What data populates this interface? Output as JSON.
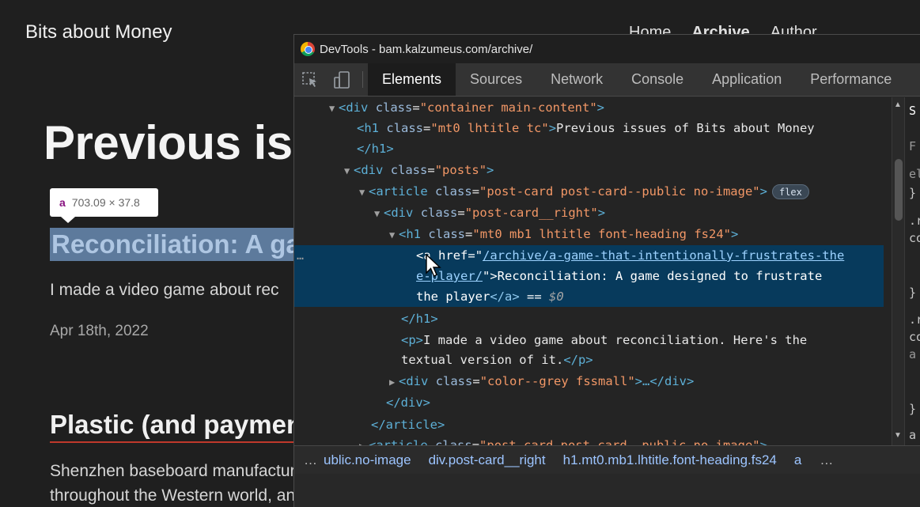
{
  "site": {
    "title": "Bits about Money",
    "nav": [
      "Home",
      "Archive",
      "Author"
    ],
    "heading": "Previous issu"
  },
  "inspect_tooltip": {
    "tag": "a",
    "size": "703.09 × 37.8"
  },
  "posts": [
    {
      "title": "Reconciliation: A ga",
      "excerpt": "I made a video game about rec",
      "date": "Apr 18th, 2022"
    },
    {
      "title": "Plastic (and paymen",
      "excerpt": "Shenzhen baseboard manufacturers, blockchain U.S. tech companies, mom-and-pop factories throughout the Western world, and a global network of artisans bringing a bit of magic to your"
    }
  ],
  "devtools": {
    "title": "DevTools - bam.kalzumeus.com/archive/",
    "tabs": [
      "Elements",
      "Sources",
      "Network",
      "Console",
      "Application",
      "Performance"
    ],
    "active_tab": "Elements",
    "flex_badge": "flex",
    "dom": {
      "l1": "div",
      "l1_attr": "class",
      "l1_val": "\"container main-content\"",
      "l2": "h1",
      "l2_attr": "class",
      "l2_val": "\"mt0 lhtitle tc\"",
      "l2_text": "Previous issues of Bits about Money",
      "l3": "</h1>",
      "l4": "div",
      "l4_attr": "class",
      "l4_val": "\"posts\"",
      "l5": "article",
      "l5_attr": "class",
      "l5_val": "\"post-card post-card--public no-image\"",
      "l6": "div",
      "l6_attr": "class",
      "l6_val": "\"post-card__right\"",
      "l7": "h1",
      "l7_attr": "class",
      "l7_val": "\"mt0 mb1 lhtitle font-heading fs24\"",
      "sel_tag": "a",
      "sel_attr": "href",
      "sel_href_1": "/archive/a-game-that-intentionally-frustrates-the",
      "sel_href_2": "e-player/",
      "sel_text_1": "Reconciliation: A game designed to frustrate",
      "sel_text_2": "the player",
      "sel_close": "</a>",
      "sel_eq": "== ",
      "sel_dollar": "$0",
      "l9": "</h1>",
      "l10_text_1": "I made a video game about reconciliation. Here's the",
      "l10_text_2": "textual version of it.",
      "l11": "div",
      "l11_attr": "class",
      "l11_val": "\"color--grey fssmall\"",
      "l11_tail": "…</div>",
      "l12": "</div>",
      "l13": "</article>",
      "l14": "article",
      "l14_attr": "class",
      "l14_val": "\"post-card post-card--public no-image\""
    },
    "styles_fragments": [
      "S",
      "F",
      "el",
      "}",
      ".r",
      "co",
      "}",
      ".r",
      "co",
      "a",
      "}",
      "a"
    ],
    "breadcrumbs": [
      "ublic.no-image",
      "div.post-card__right",
      "h1.mt0.mb1.lhtitle.font-heading.fs24",
      "a"
    ],
    "breadcrumb_more": "…"
  }
}
